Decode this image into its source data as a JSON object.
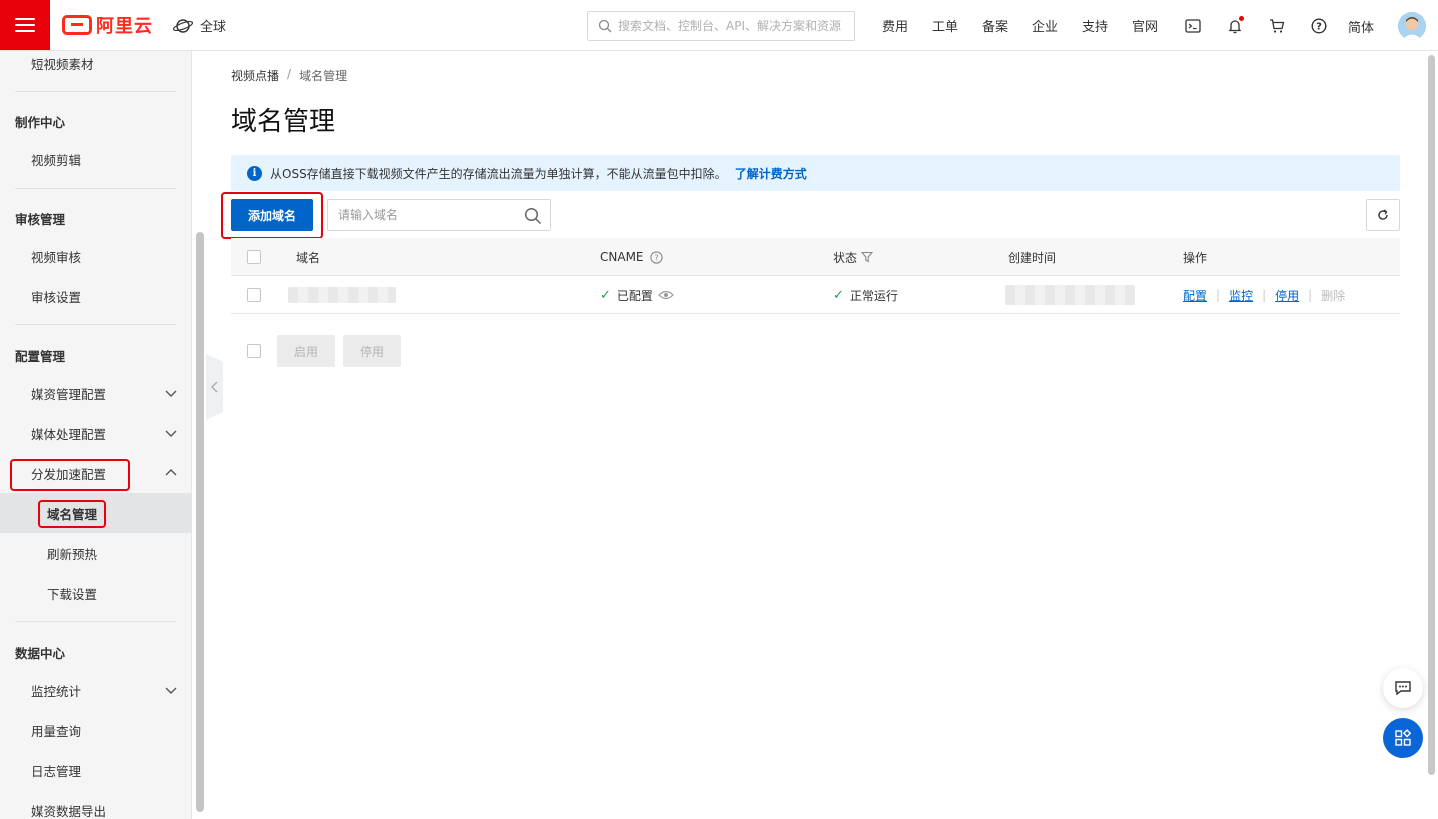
{
  "topbar": {
    "logo_text": "阿里云",
    "region_label": "全球",
    "search_placeholder": "搜索文档、控制台、API、解决方案和资源",
    "nav": [
      "费用",
      "工单",
      "备案",
      "企业",
      "支持",
      "官网"
    ],
    "icons": [
      "terminal-icon",
      "bell-icon",
      "cart-icon",
      "help-icon"
    ],
    "language": "简体"
  },
  "sidebar": {
    "items": {
      "short_video": "短视频素材",
      "group_produce": "制作中心",
      "video_edit": "视频剪辑",
      "group_audit": "审核管理",
      "video_audit": "视频审核",
      "audit_settings": "审核设置",
      "group_config": "配置管理",
      "media_config": "媒资管理配置",
      "media_process": "媒体处理配置",
      "cdn_config": "分发加速配置",
      "domain_mgmt": "域名管理",
      "refresh": "刷新预热",
      "download": "下载设置",
      "group_data": "数据中心",
      "monitor": "监控统计",
      "usage": "用量查询",
      "logs": "日志管理",
      "export": "媒资数据导出"
    }
  },
  "breadcrumb": {
    "root": "视频点播",
    "sep": "/",
    "current": "域名管理"
  },
  "page": {
    "title": "域名管理",
    "notice": "从OSS存储直接下载视频文件产生的存储流出流量为单独计算，不能从流量包中扣除。",
    "notice_link": "了解计费方式",
    "add_button": "添加域名",
    "search_placeholder": "请输入域名"
  },
  "table": {
    "headers": {
      "domain": "域名",
      "cname": "CNAME",
      "status": "状态",
      "created": "创建时间",
      "actions": "操作"
    },
    "rows": [
      {
        "cname": "已配置",
        "status": "正常运行",
        "actions": {
          "config": "配置",
          "monitor": "监控",
          "disable": "停用",
          "delete": "删除"
        }
      }
    ]
  },
  "batch": {
    "enable": "启用",
    "disable": "停用"
  },
  "colors": {
    "brand_red": "#e8000b",
    "primary_blue": "#0064c8",
    "success_green": "#1e9e4f",
    "notice_bg": "#e5f3ff"
  }
}
